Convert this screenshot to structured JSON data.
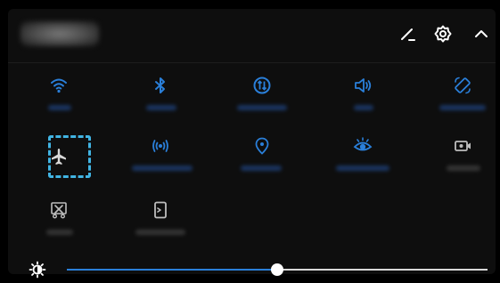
{
  "header": {
    "icons": [
      "edit-icon",
      "settings-icon",
      "collapse-icon"
    ]
  },
  "toggles": [
    {
      "icon": "wifi-icon",
      "state": "on"
    },
    {
      "icon": "bluetooth-icon",
      "state": "on"
    },
    {
      "icon": "mobile-data-icon",
      "state": "on"
    },
    {
      "icon": "sound-icon",
      "state": "on"
    },
    {
      "icon": "auto-rotate-icon",
      "state": "on"
    },
    {
      "icon": "airplane-mode-icon",
      "state": "off",
      "selected": true
    },
    {
      "icon": "hotspot-icon",
      "state": "on"
    },
    {
      "icon": "location-icon",
      "state": "on"
    },
    {
      "icon": "eye-comfort-icon",
      "state": "on"
    },
    {
      "icon": "screen-recorder-icon",
      "state": "off"
    },
    {
      "icon": "screenshot-icon",
      "state": "off"
    },
    {
      "icon": "huawei-share-icon",
      "state": "off"
    }
  ],
  "brightness": {
    "icon": "brightness-icon",
    "level": 0.5
  },
  "colors": {
    "active": "#2a7fd9",
    "inactive": "#bdbdbd",
    "selection": "#41b4e3",
    "header_icon": "#ffffff"
  }
}
